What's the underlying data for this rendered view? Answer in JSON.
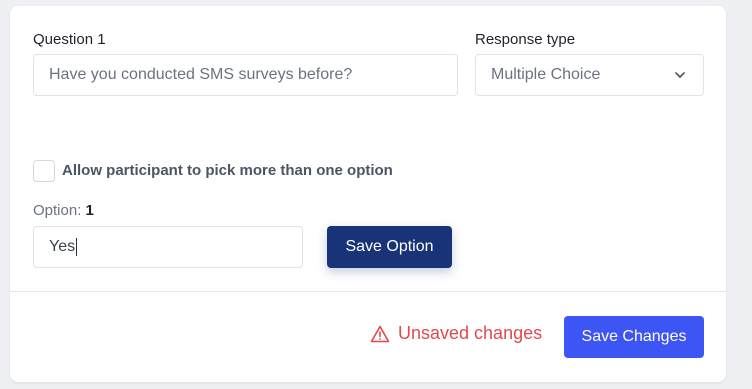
{
  "question": {
    "label": "Question 1",
    "placeholder": "Have you conducted SMS surveys before?"
  },
  "response_type": {
    "label": "Response type",
    "selected": "Multiple Choice",
    "icon": "chevron-down-icon"
  },
  "multi_select": {
    "label": "Allow participant to pick more than one option",
    "checked": false
  },
  "option": {
    "label_prefix": "Option:",
    "number": "1",
    "value": "Yes",
    "save_label": "Save Option"
  },
  "footer": {
    "unsaved_text": "Unsaved changes",
    "unsaved_icon": "warning-triangle-icon",
    "save_changes_label": "Save Changes"
  },
  "colors": {
    "primary_dark": "#183378",
    "primary": "#3d55f5",
    "danger": "#e5484d"
  }
}
